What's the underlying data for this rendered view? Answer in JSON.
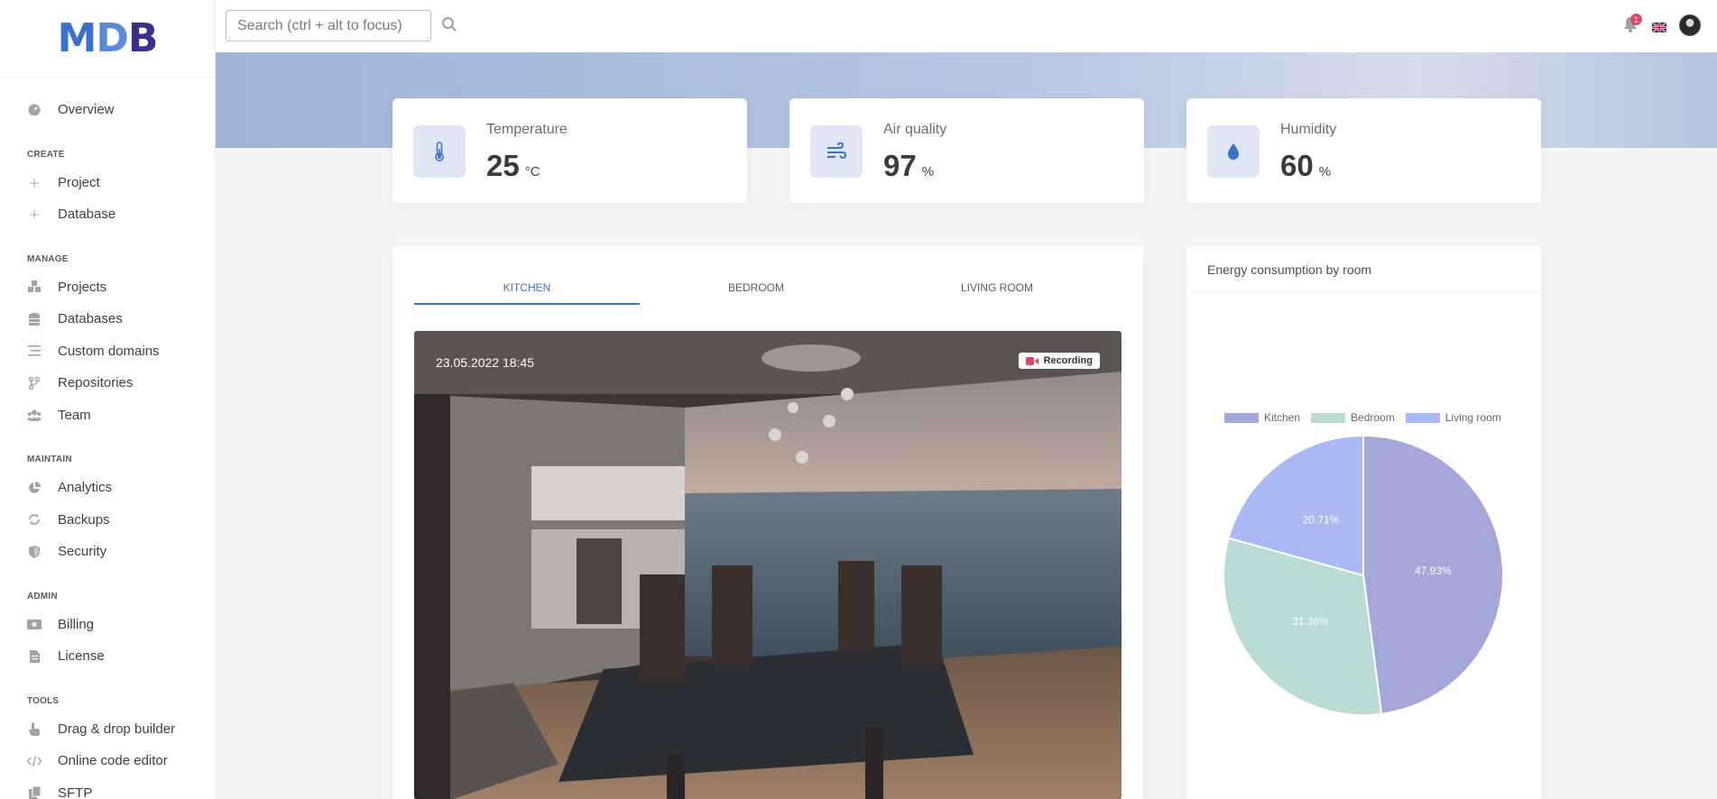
{
  "sidebar": {
    "overview": "Overview",
    "sections": {
      "create": "CREATE",
      "manage": "MANAGE",
      "maintain": "MAINTAIN",
      "admin": "ADMIN",
      "tools": "TOOLS"
    },
    "create_items": [
      "Project",
      "Database"
    ],
    "manage_items": [
      "Projects",
      "Databases",
      "Custom domains",
      "Repositories",
      "Team"
    ],
    "maintain_items": [
      "Analytics",
      "Backups",
      "Security"
    ],
    "admin_items": [
      "Billing",
      "License"
    ],
    "tools_items": [
      "Drag & drop builder",
      "Online code editor",
      "SFTP"
    ]
  },
  "topbar": {
    "search_placeholder": "Search (ctrl + alt to focus)",
    "notification_count": "1"
  },
  "stats": [
    {
      "label": "Temperature",
      "value": "25",
      "unit": "°C",
      "icon": "thermometer-icon"
    },
    {
      "label": "Air quality",
      "value": "97",
      "unit": "%",
      "icon": "wind-icon"
    },
    {
      "label": "Humidity",
      "value": "60",
      "unit": "%",
      "icon": "droplet-icon"
    }
  ],
  "camera": {
    "tabs": [
      "KITCHEN",
      "BEDROOM",
      "LIVING ROOM"
    ],
    "active_tab": 0,
    "timestamp": "23.05.2022 18:45",
    "status": "Recording"
  },
  "energy": {
    "title": "Energy consumption by room"
  },
  "chart_data": {
    "type": "pie",
    "title": "Energy consumption by room",
    "labels": [
      "Kitchen",
      "Bedroom",
      "Living room"
    ],
    "values": [
      47.93,
      31.36,
      20.71
    ],
    "value_labels": [
      "47.93%",
      "31.36%",
      "20.71%"
    ],
    "colors": [
      "#a3a8d8",
      "#b9dbd3",
      "#aab9f3"
    ],
    "legend_position": "top"
  },
  "colors": {
    "accent": "#3b71ca",
    "badge": "#dc4c64"
  }
}
